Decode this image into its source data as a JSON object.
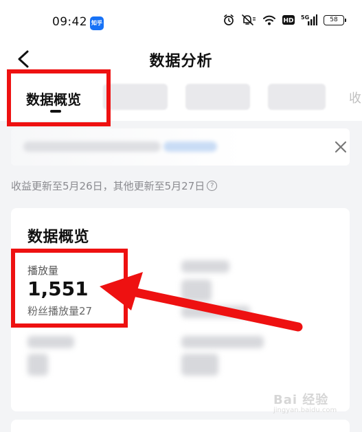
{
  "status_bar": {
    "time": "09:42",
    "app_badge": "知乎",
    "network_label": "5G",
    "hd_label": "HD",
    "battery_level": "58",
    "icons": [
      "alarm-icon",
      "mute-icon",
      "wifi-icon",
      "hd-icon",
      "5g-signal-icon",
      "battery-icon"
    ]
  },
  "header": {
    "title": "数据分析",
    "back_icon": "chevron-left-icon"
  },
  "tabs": {
    "active_label": "数据概览",
    "more_label": "收"
  },
  "banner": {
    "close_icon": "close-icon"
  },
  "update_note": {
    "text": "收益更新至5月26日，其他更新至5月27日",
    "help_icon": "?"
  },
  "card": {
    "title": "数据概览",
    "metric": {
      "label": "播放量",
      "value": "1,551",
      "sub": "粉丝播放量27"
    }
  },
  "watermark": {
    "main": "Bai 经验",
    "sub": "jingyan.baidu.com"
  },
  "annotation": {
    "color": "#ee1111"
  }
}
